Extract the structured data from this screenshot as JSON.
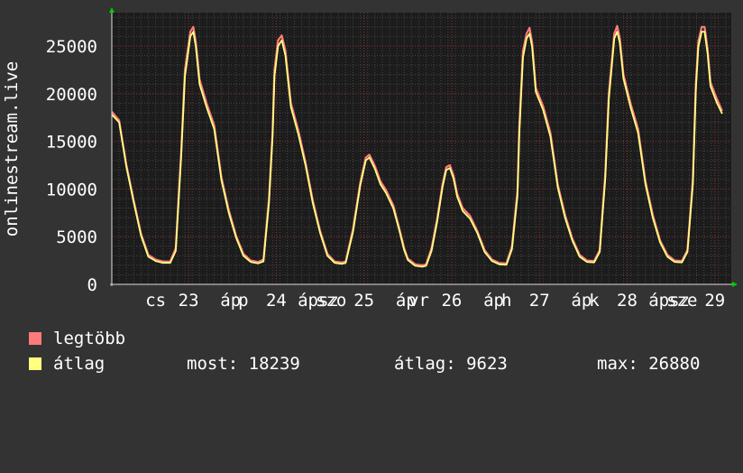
{
  "chart_data": {
    "type": "line",
    "ylabel": "onlinestream.live",
    "ylim": [
      0,
      28500
    ],
    "yticks": [
      0,
      5000,
      10000,
      15000,
      20000,
      25000
    ],
    "xlim": [
      0,
      169.5
    ],
    "xticks": [
      {
        "x": 12,
        "label": "cs"
      },
      {
        "x": 21,
        "label": "23"
      },
      {
        "x": 32.5,
        "label": "áp"
      },
      {
        "x": 36,
        "label": "p"
      },
      {
        "x": 45,
        "label": "24"
      },
      {
        "x": 56.5,
        "label": "ápsz"
      },
      {
        "x": 60,
        "label": "szo"
      },
      {
        "x": 69,
        "label": "25"
      },
      {
        "x": 80.5,
        "label": "áp"
      },
      {
        "x": 84,
        "label": "vr"
      },
      {
        "x": 93,
        "label": "26"
      },
      {
        "x": 104.5,
        "label": "áp"
      },
      {
        "x": 108,
        "label": "h"
      },
      {
        "x": 117,
        "label": "27"
      },
      {
        "x": 128.5,
        "label": "áp"
      },
      {
        "x": 132,
        "label": "k"
      },
      {
        "x": 141,
        "label": "28"
      },
      {
        "x": 152.5,
        "label": "ápsz"
      },
      {
        "x": 156,
        "label": "sze"
      },
      {
        "x": 165,
        "label": "29"
      }
    ],
    "grid": true,
    "series": [
      {
        "name": "legtöbb",
        "color": "#ff7b7b",
        "points": [
          [
            0,
            18100
          ],
          [
            2,
            17200
          ],
          [
            4,
            12500
          ],
          [
            6,
            8800
          ],
          [
            8,
            5300
          ],
          [
            10,
            3100
          ],
          [
            12,
            2600
          ],
          [
            14,
            2400
          ],
          [
            16,
            2400
          ],
          [
            17.5,
            3800
          ],
          [
            19,
            14000
          ],
          [
            20,
            22500
          ],
          [
            21.5,
            26500
          ],
          [
            22.3,
            27000
          ],
          [
            23,
            25400
          ],
          [
            24,
            21500
          ],
          [
            26,
            18900
          ],
          [
            28,
            16700
          ],
          [
            30,
            11200
          ],
          [
            32,
            7800
          ],
          [
            34,
            5100
          ],
          [
            36,
            3200
          ],
          [
            38,
            2500
          ],
          [
            40,
            2350
          ],
          [
            41.5,
            2600
          ],
          [
            43,
            9000
          ],
          [
            44,
            16000
          ],
          [
            44.5,
            22500
          ],
          [
            45.5,
            25600
          ],
          [
            46.5,
            26100
          ],
          [
            47.5,
            24500
          ],
          [
            49,
            19000
          ],
          [
            51,
            16200
          ],
          [
            53,
            12800
          ],
          [
            55,
            8800
          ],
          [
            57,
            5600
          ],
          [
            59,
            3200
          ],
          [
            61,
            2400
          ],
          [
            63,
            2300
          ],
          [
            64,
            2400
          ],
          [
            66,
            5800
          ],
          [
            68,
            10700
          ],
          [
            69.5,
            13300
          ],
          [
            70.5,
            13600
          ],
          [
            72,
            12400
          ],
          [
            73.5,
            10800
          ],
          [
            75,
            9900
          ],
          [
            77,
            8300
          ],
          [
            78.5,
            6100
          ],
          [
            80,
            3800
          ],
          [
            81,
            2700
          ],
          [
            83,
            2100
          ],
          [
            85,
            2000
          ],
          [
            86,
            2100
          ],
          [
            87.5,
            3800
          ],
          [
            89,
            6800
          ],
          [
            90.5,
            10500
          ],
          [
            91.5,
            12300
          ],
          [
            92.5,
            12500
          ],
          [
            93.5,
            11400
          ],
          [
            94.5,
            9500
          ],
          [
            96,
            8000
          ],
          [
            98,
            7200
          ],
          [
            100,
            5600
          ],
          [
            102,
            3600
          ],
          [
            104,
            2600
          ],
          [
            106,
            2250
          ],
          [
            108,
            2200
          ],
          [
            109.5,
            4000
          ],
          [
            111,
            9800
          ],
          [
            111.5,
            16500
          ],
          [
            112.5,
            24500
          ],
          [
            113.5,
            26300
          ],
          [
            114.3,
            26900
          ],
          [
            115,
            25400
          ],
          [
            116,
            20600
          ],
          [
            118,
            18700
          ],
          [
            120,
            15900
          ],
          [
            122,
            10500
          ],
          [
            124,
            7300
          ],
          [
            126,
            4800
          ],
          [
            128,
            3100
          ],
          [
            130,
            2500
          ],
          [
            132,
            2450
          ],
          [
            133.5,
            3600
          ],
          [
            135,
            11500
          ],
          [
            136,
            20000
          ],
          [
            137.5,
            26300
          ],
          [
            138.3,
            27100
          ],
          [
            139,
            25800
          ],
          [
            140,
            22000
          ],
          [
            142,
            18900
          ],
          [
            144,
            16300
          ],
          [
            146,
            10800
          ],
          [
            148,
            7300
          ],
          [
            150,
            4600
          ],
          [
            152,
            3100
          ],
          [
            154,
            2500
          ],
          [
            156,
            2450
          ],
          [
            157.5,
            3600
          ],
          [
            159,
            11000
          ],
          [
            159.8,
            21000
          ],
          [
            160.5,
            25500
          ],
          [
            161.4,
            27000
          ],
          [
            162.2,
            27000
          ],
          [
            163,
            24700
          ],
          [
            163.8,
            21200
          ],
          [
            165.5,
            19500
          ],
          [
            167,
            18200
          ]
        ]
      },
      {
        "name": "átlag",
        "color": "#ffff80",
        "points": [
          [
            0,
            17800
          ],
          [
            2,
            17000
          ],
          [
            4,
            12300
          ],
          [
            6,
            8600
          ],
          [
            8,
            5100
          ],
          [
            10,
            2900
          ],
          [
            12,
            2450
          ],
          [
            14,
            2250
          ],
          [
            16,
            2250
          ],
          [
            17.5,
            3500
          ],
          [
            19,
            13500
          ],
          [
            20,
            21800
          ],
          [
            21.5,
            26000
          ],
          [
            22.3,
            26500
          ],
          [
            23,
            24900
          ],
          [
            24,
            21000
          ],
          [
            26,
            18500
          ],
          [
            28,
            16300
          ],
          [
            30,
            10900
          ],
          [
            32,
            7500
          ],
          [
            34,
            4900
          ],
          [
            36,
            3000
          ],
          [
            38,
            2350
          ],
          [
            40,
            2200
          ],
          [
            41.5,
            2400
          ],
          [
            43,
            8500
          ],
          [
            44,
            15500
          ],
          [
            44.5,
            21800
          ],
          [
            45.5,
            25000
          ],
          [
            46.5,
            25600
          ],
          [
            47.5,
            24000
          ],
          [
            49,
            18600
          ],
          [
            51,
            15800
          ],
          [
            53,
            12500
          ],
          [
            55,
            8500
          ],
          [
            57,
            5400
          ],
          [
            59,
            3000
          ],
          [
            61,
            2250
          ],
          [
            63,
            2150
          ],
          [
            64,
            2250
          ],
          [
            66,
            5500
          ],
          [
            68,
            10400
          ],
          [
            69.5,
            13000
          ],
          [
            70.5,
            13300
          ],
          [
            72,
            12100
          ],
          [
            73.5,
            10500
          ],
          [
            75,
            9600
          ],
          [
            77,
            8000
          ],
          [
            78.5,
            5900
          ],
          [
            80,
            3600
          ],
          [
            81,
            2550
          ],
          [
            83,
            1950
          ],
          [
            85,
            1850
          ],
          [
            86,
            1950
          ],
          [
            87.5,
            3500
          ],
          [
            89,
            6500
          ],
          [
            90.5,
            10200
          ],
          [
            91.5,
            12000
          ],
          [
            92.5,
            12200
          ],
          [
            93.5,
            11100
          ],
          [
            94.5,
            9200
          ],
          [
            96,
            7700
          ],
          [
            98,
            6900
          ],
          [
            100,
            5400
          ],
          [
            102,
            3400
          ],
          [
            104,
            2450
          ],
          [
            106,
            2100
          ],
          [
            108,
            2050
          ],
          [
            109.5,
            3700
          ],
          [
            111,
            9300
          ],
          [
            111.5,
            15800
          ],
          [
            112.5,
            23800
          ],
          [
            113.5,
            25800
          ],
          [
            114.3,
            26300
          ],
          [
            115,
            24900
          ],
          [
            116,
            20200
          ],
          [
            118,
            18300
          ],
          [
            120,
            15500
          ],
          [
            122,
            10200
          ],
          [
            124,
            7000
          ],
          [
            126,
            4600
          ],
          [
            128,
            2900
          ],
          [
            130,
            2350
          ],
          [
            132,
            2300
          ],
          [
            133.5,
            3400
          ],
          [
            135,
            11000
          ],
          [
            136,
            19400
          ],
          [
            137.5,
            25800
          ],
          [
            138.3,
            26500
          ],
          [
            139,
            25300
          ],
          [
            140,
            21600
          ],
          [
            142,
            18500
          ],
          [
            144,
            15900
          ],
          [
            146,
            10500
          ],
          [
            148,
            7000
          ],
          [
            150,
            4400
          ],
          [
            152,
            2900
          ],
          [
            154,
            2350
          ],
          [
            156,
            2300
          ],
          [
            157.5,
            3400
          ],
          [
            159,
            10500
          ],
          [
            159.8,
            20400
          ],
          [
            160.5,
            24900
          ],
          [
            161.4,
            26500
          ],
          [
            162.2,
            26500
          ],
          [
            163,
            24200
          ],
          [
            163.8,
            20800
          ],
          [
            165.5,
            19100
          ],
          [
            167,
            17900
          ]
        ]
      }
    ]
  },
  "legend": [
    {
      "label": "legtöbb",
      "color": "#ff7b7b"
    },
    {
      "label": "átlag",
      "color": "#ffff80"
    }
  ],
  "stats": {
    "most": "most: 18239",
    "atlag": "átlag: 9623",
    "max": "max: 26880"
  }
}
